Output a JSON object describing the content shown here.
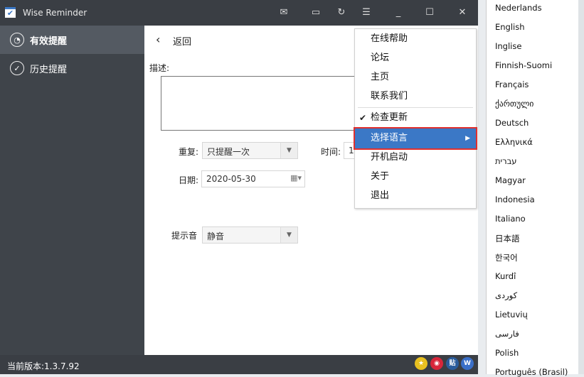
{
  "app": {
    "title": "Wise Reminder",
    "version": "当前版本:1.3.7.92"
  },
  "sidebar": {
    "items": [
      {
        "label": "有效提醒"
      },
      {
        "label": "历史提醒"
      }
    ]
  },
  "main": {
    "back": "返回",
    "desc_label": "描述:",
    "desc_value": "",
    "repeat_label": "重复:",
    "repeat_value": "只提醒一次",
    "time_label": "时间:",
    "time_value": "17",
    "date_label": "日期:",
    "date_value": "2020-05-30",
    "sound_label": "提示音",
    "sound_value": "静音"
  },
  "menu": {
    "items": [
      "在线帮助",
      "论坛",
      "主页",
      "联系我们",
      "检查更新",
      "选择语言",
      "开机启动",
      "关于",
      "退出"
    ],
    "checked": "检查更新",
    "highlight": "选择语言"
  },
  "languages": [
    "Nederlands",
    "English",
    "Inglise",
    "Finnish-Suomi",
    "Français",
    "ქართული",
    "Deutsch",
    "Ελληνικά",
    "עברית",
    "Magyar",
    "Indonesia",
    "Italiano",
    "日本語",
    "한국어",
    "Kurdî",
    "کوردی",
    "Lietuvių",
    "فارسی",
    "Polish",
    "Português (Brasil)"
  ],
  "social": [
    "贴",
    "W"
  ],
  "colors": {
    "highlight": "#3b78c6",
    "outline": "#e0302e",
    "dark": "#3a3e44"
  }
}
